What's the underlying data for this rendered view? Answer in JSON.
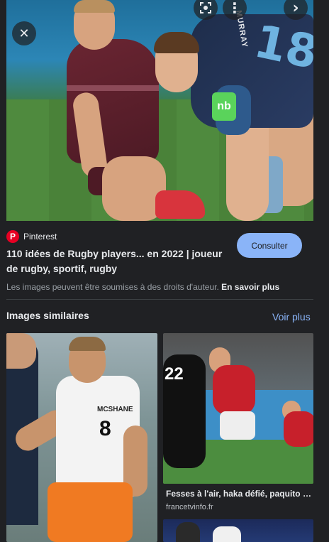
{
  "hero": {
    "jersey_name": "MURRAY",
    "jersey_number": "18",
    "badge": "nb"
  },
  "controls": {
    "close_glyph": "✕",
    "more_glyph": "⋮",
    "next_glyph": "›"
  },
  "result": {
    "source_name": "Pinterest",
    "source_logo": "P",
    "title": "110 idées de Rugby players... en 2022 | joueur de rugby, sportif, rugby",
    "action_label": "Consulter",
    "copyright_text": "Les images peuvent être soumises à des droits d'auteur.",
    "learn_more": "En savoir plus"
  },
  "similar": {
    "heading": "Images similaires",
    "see_more": "Voir plus",
    "items": [
      {
        "jersey_name": "MCSHANE",
        "jersey_number": "8"
      },
      {
        "jersey_number": "22",
        "caption": "Fesses à l'air, haka défié, paquito fr...",
        "source": "francetvinfo.fr"
      }
    ]
  },
  "colors": {
    "background": "#202124",
    "accent": "#8ab4f8",
    "pinterest_red": "#e60023"
  }
}
